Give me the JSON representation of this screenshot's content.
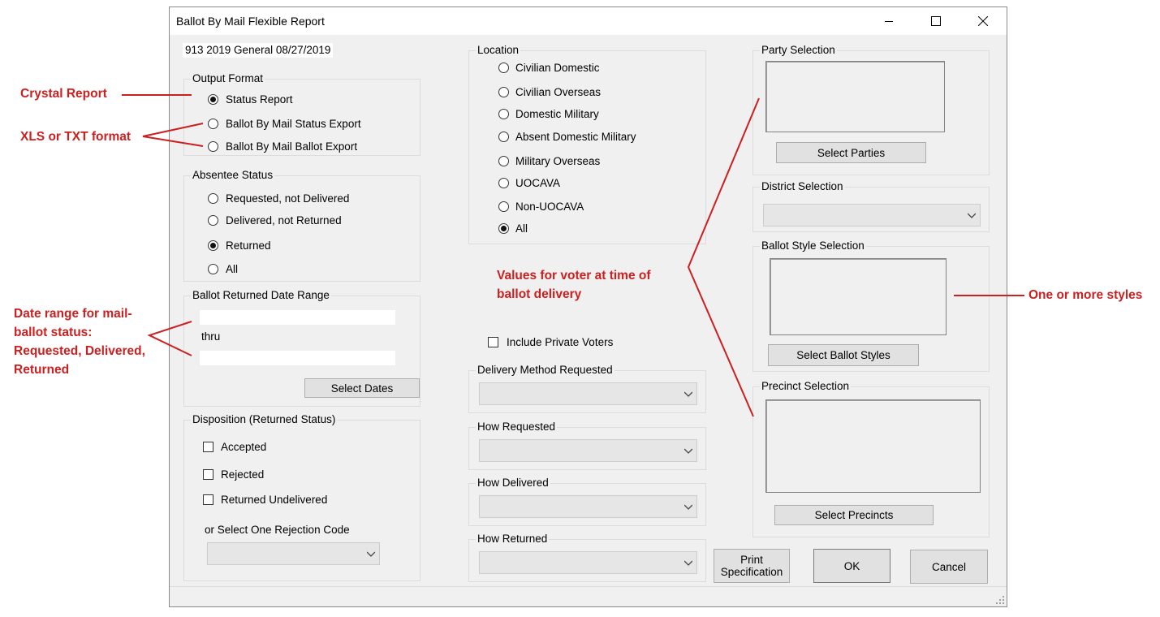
{
  "window": {
    "title": "Ballot By Mail Flexible Report",
    "election": "913 2019 General 08/27/2019"
  },
  "output_format": {
    "legend": "Output Format",
    "options": [
      "Status Report",
      "Ballot By Mail Status Export",
      "Ballot By Mail Ballot Export"
    ],
    "selected": "Status Report"
  },
  "absentee_status": {
    "legend": "Absentee Status",
    "options": [
      "Requested, not Delivered",
      "Delivered, not Returned",
      "Returned",
      "All"
    ],
    "selected": "Returned"
  },
  "date_range": {
    "legend": "Ballot Returned Date Range",
    "from_value": "",
    "thru_label": "thru",
    "to_value": "",
    "select_button": "Select Dates"
  },
  "disposition": {
    "legend": "Disposition (Returned Status)",
    "options": [
      "Accepted",
      "Rejected",
      "Returned Undelivered"
    ],
    "rejection_label": "or Select One Rejection Code",
    "rejection_value": ""
  },
  "location": {
    "legend": "Location",
    "options": [
      "Civilian Domestic",
      "Civilian Overseas",
      "Domestic Military",
      "Absent Domestic Military",
      "Military Overseas",
      "UOCAVA",
      "Non-UOCAVA",
      "All"
    ],
    "selected": "All"
  },
  "private_voters": {
    "label": "Include Private Voters",
    "checked": false
  },
  "delivery_method": {
    "label": "Delivery Method Requested",
    "value": ""
  },
  "how_requested": {
    "label": "How Requested",
    "value": ""
  },
  "how_delivered": {
    "label": "How Delivered",
    "value": ""
  },
  "how_returned": {
    "label": "How Returned",
    "value": ""
  },
  "party": {
    "legend": "Party Selection",
    "button": "Select Parties"
  },
  "district": {
    "legend": "District Selection",
    "value": ""
  },
  "ballot_style": {
    "legend": "Ballot Style Selection",
    "button": "Select Ballot Styles"
  },
  "precinct": {
    "legend": "Precinct Selection",
    "button": "Select Precincts"
  },
  "buttons": {
    "print_spec_line1": "Print",
    "print_spec_line2": "Specification",
    "ok": "OK",
    "cancel": "Cancel"
  },
  "annotations": {
    "crystal": "Crystal Report",
    "xls": "XLS or TXT format",
    "date_line1": "Date range for mail-",
    "date_line2": "ballot status:",
    "date_line3": "Requested, Delivered,",
    "date_line4": "Returned",
    "values_line1": "Values for voter at time of",
    "values_line2": "ballot delivery",
    "styles": "One or more styles"
  },
  "colors": {
    "annotation": "#cc1f1f",
    "window_bg": "#f0f0f0",
    "button_bg": "#e1e1e1"
  }
}
